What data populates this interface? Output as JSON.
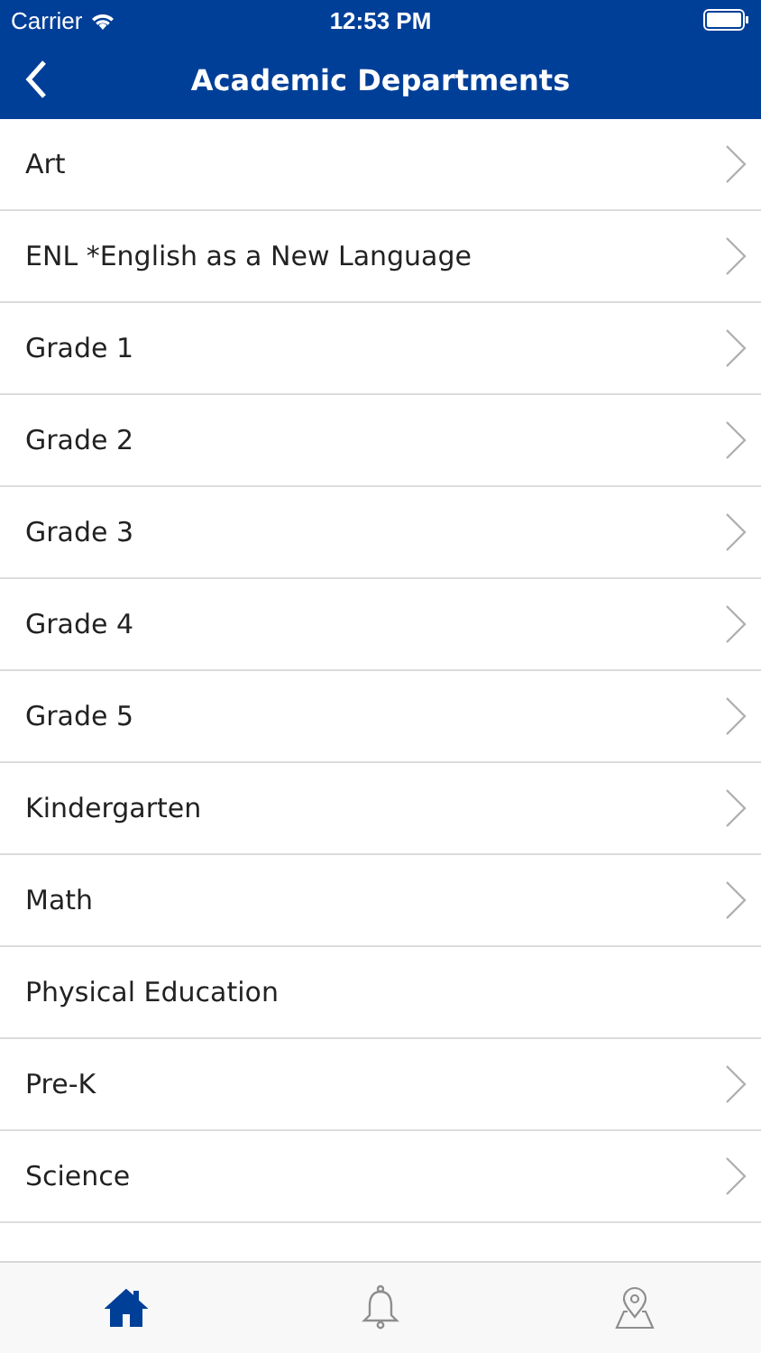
{
  "status_bar": {
    "carrier": "Carrier",
    "time": "12:53 PM"
  },
  "nav": {
    "title": "Academic Departments"
  },
  "rows": [
    {
      "label": "Art",
      "chevron": true
    },
    {
      "label": "ENL *English as a New Language",
      "chevron": true
    },
    {
      "label": "Grade 1",
      "chevron": true
    },
    {
      "label": "Grade 2",
      "chevron": true
    },
    {
      "label": "Grade 3",
      "chevron": true
    },
    {
      "label": "Grade 4",
      "chevron": true
    },
    {
      "label": "Grade 5",
      "chevron": true
    },
    {
      "label": "Kindergarten",
      "chevron": true
    },
    {
      "label": "Math",
      "chevron": true
    },
    {
      "label": "Physical Education",
      "chevron": false
    },
    {
      "label": "Pre-K",
      "chevron": true
    },
    {
      "label": "Science",
      "chevron": true
    }
  ],
  "tabs": [
    {
      "kind": "home",
      "selected": true
    },
    {
      "kind": "bell",
      "selected": false
    },
    {
      "kind": "map",
      "selected": false
    }
  ]
}
